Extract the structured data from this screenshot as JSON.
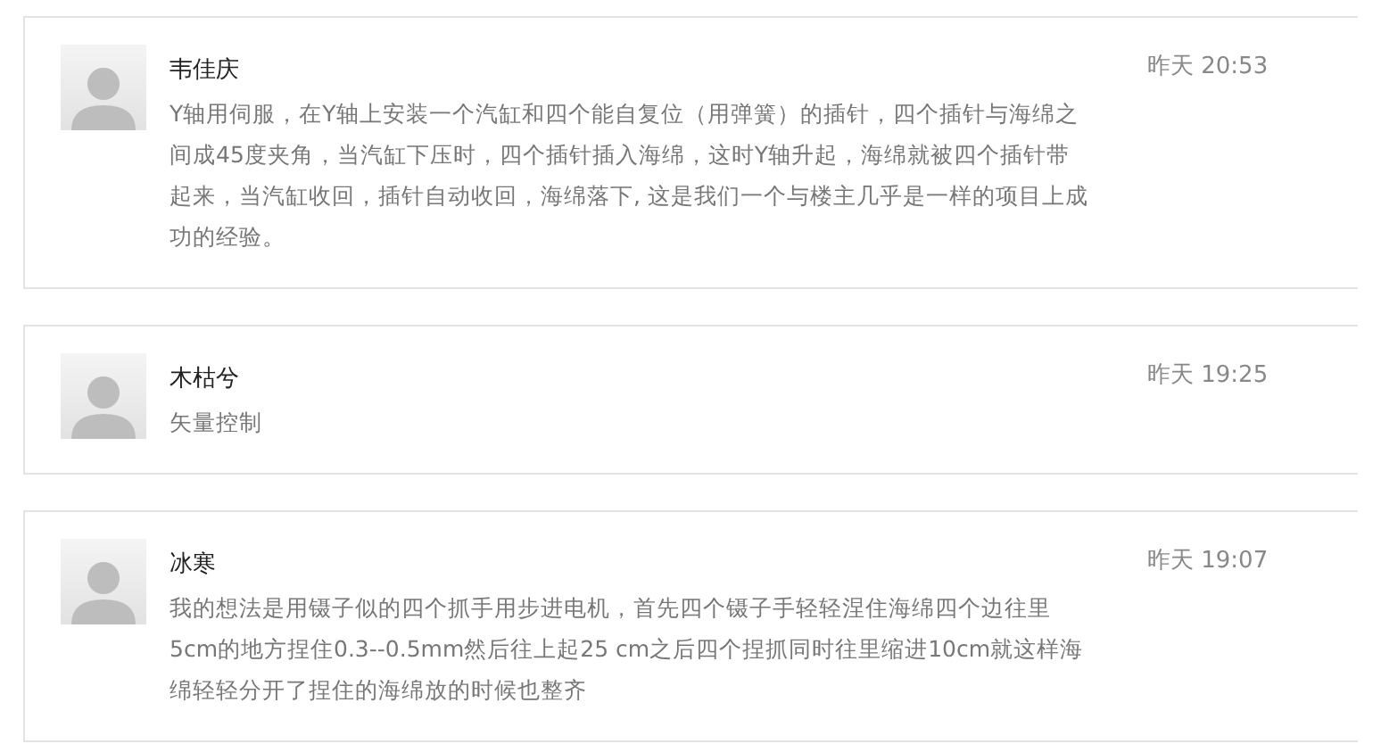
{
  "comments": [
    {
      "author": "韦佳庆",
      "time": "昨天 20:53",
      "text": "Y轴用伺服，在Y轴上安装一个汽缸和四个能自复位（用弹簧）的插针，四个插针与海绵之间成45度夹角，当汽缸下压时，四个插针插入海绵，这时Y轴升起，海绵就被四个插针带起来，当汽缸收回，插针自动收回，海绵落下, 这是我们一个与楼主几乎是一样的项目上成功的经验。"
    },
    {
      "author": "木枯兮",
      "time": "昨天 19:25",
      "text": "矢量控制"
    },
    {
      "author": "冰寒",
      "time": "昨天 19:07",
      "text": "我的想法是用镊子似的四个抓手用步进电机，首先四个镊子手轻轻涅住海绵四个边往里5cm的地方捏住0.3--0.5mm然后往上起25 cm之后四个捏抓同时往里缩进10cm就这样海绵轻轻分开了捏住的海绵放的时候也整齐"
    }
  ]
}
